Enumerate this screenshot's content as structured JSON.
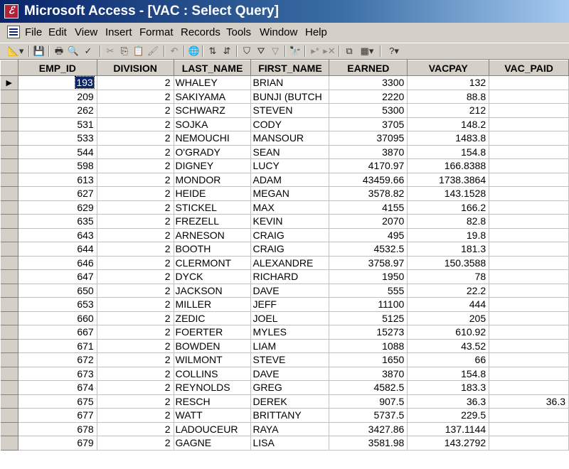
{
  "window": {
    "title": "Microsoft Access - [VAC : Select Query]",
    "app_icon": "access-key-icon"
  },
  "menu": [
    {
      "label": "File"
    },
    {
      "label": "Edit"
    },
    {
      "label": "View"
    },
    {
      "label": "Insert"
    },
    {
      "label": "Format"
    },
    {
      "label": "Records"
    },
    {
      "label": "Tools"
    },
    {
      "label": "Window"
    },
    {
      "label": "Help"
    }
  ],
  "toolbar": {
    "icons": [
      "view-design-icon",
      "save-icon",
      "print-icon",
      "print-preview-icon",
      "spelling-icon",
      "cut-icon",
      "copy-icon",
      "paste-icon",
      "format-painter-icon",
      "undo-icon",
      "hyperlink-icon",
      "sort-ascending-icon",
      "sort-descending-icon",
      "filter-by-selection-icon",
      "filter-by-form-icon",
      "apply-filter-icon",
      "find-icon",
      "new-record-icon",
      "delete-record-icon",
      "database-window-icon",
      "new-object-icon",
      "help-icon"
    ]
  },
  "grid": {
    "columns": [
      "EMP_ID",
      "DIVISION",
      "LAST_NAME",
      "FIRST_NAME",
      "EARNED",
      "VACPAY",
      "VAC_PAID"
    ],
    "current_row_indicator": "▶",
    "rows": [
      [
        "193",
        "2",
        "WHALEY",
        "BRIAN",
        "3300",
        "132",
        ""
      ],
      [
        "209",
        "2",
        "SAKIYAMA",
        "BUNJI (BUTCH",
        "2220",
        "88.8",
        ""
      ],
      [
        "262",
        "2",
        "SCHWARZ",
        "STEVEN",
        "5300",
        "212",
        ""
      ],
      [
        "531",
        "2",
        "SOJKA",
        "CODY",
        "3705",
        "148.2",
        ""
      ],
      [
        "533",
        "2",
        "NEMOUCHI",
        "MANSOUR",
        "37095",
        "1483.8",
        ""
      ],
      [
        "544",
        "2",
        "O'GRADY",
        "SEAN",
        "3870",
        "154.8",
        ""
      ],
      [
        "598",
        "2",
        "DIGNEY",
        "LUCY",
        "4170.97",
        "166.8388",
        ""
      ],
      [
        "613",
        "2",
        "MONDOR",
        "ADAM",
        "43459.66",
        "1738.3864",
        ""
      ],
      [
        "627",
        "2",
        "HEIDE",
        "MEGAN",
        "3578.82",
        "143.1528",
        ""
      ],
      [
        "629",
        "2",
        "STICKEL",
        "MAX",
        "4155",
        "166.2",
        ""
      ],
      [
        "635",
        "2",
        "FREZELL",
        "KEVIN",
        "2070",
        "82.8",
        ""
      ],
      [
        "643",
        "2",
        "ARNESON",
        "CRAIG",
        "495",
        "19.8",
        ""
      ],
      [
        "644",
        "2",
        "BOOTH",
        "CRAIG",
        "4532.5",
        "181.3",
        ""
      ],
      [
        "646",
        "2",
        "CLERMONT",
        "ALEXANDRE",
        "3758.97",
        "150.3588",
        ""
      ],
      [
        "647",
        "2",
        "DYCK",
        "RICHARD",
        "1950",
        "78",
        ""
      ],
      [
        "650",
        "2",
        "JACKSON",
        "DAVE",
        "555",
        "22.2",
        ""
      ],
      [
        "653",
        "2",
        "MILLER",
        "JEFF",
        "11100",
        "444",
        ""
      ],
      [
        "660",
        "2",
        "ZEDIC",
        "JOEL",
        "5125",
        "205",
        ""
      ],
      [
        "667",
        "2",
        "FOERTER",
        "MYLES",
        "15273",
        "610.92",
        ""
      ],
      [
        "671",
        "2",
        "BOWDEN",
        "LIAM",
        "1088",
        "43.52",
        ""
      ],
      [
        "672",
        "2",
        "WILMONT",
        "STEVE",
        "1650",
        "66",
        ""
      ],
      [
        "673",
        "2",
        "COLLINS",
        "DAVE",
        "3870",
        "154.8",
        ""
      ],
      [
        "674",
        "2",
        "REYNOLDS",
        "GREG",
        "4582.5",
        "183.3",
        ""
      ],
      [
        "675",
        "2",
        "RESCH",
        "DEREK",
        "907.5",
        "36.3",
        "36.3"
      ],
      [
        "677",
        "2",
        "WATT",
        "BRITTANY",
        "5737.5",
        "229.5",
        ""
      ],
      [
        "678",
        "2",
        "LADOUCEUR",
        "RAYA",
        "3427.86",
        "137.1144",
        ""
      ],
      [
        "679",
        "2",
        "GAGNE",
        "LISA",
        "3581.98",
        "143.2792",
        ""
      ]
    ]
  }
}
